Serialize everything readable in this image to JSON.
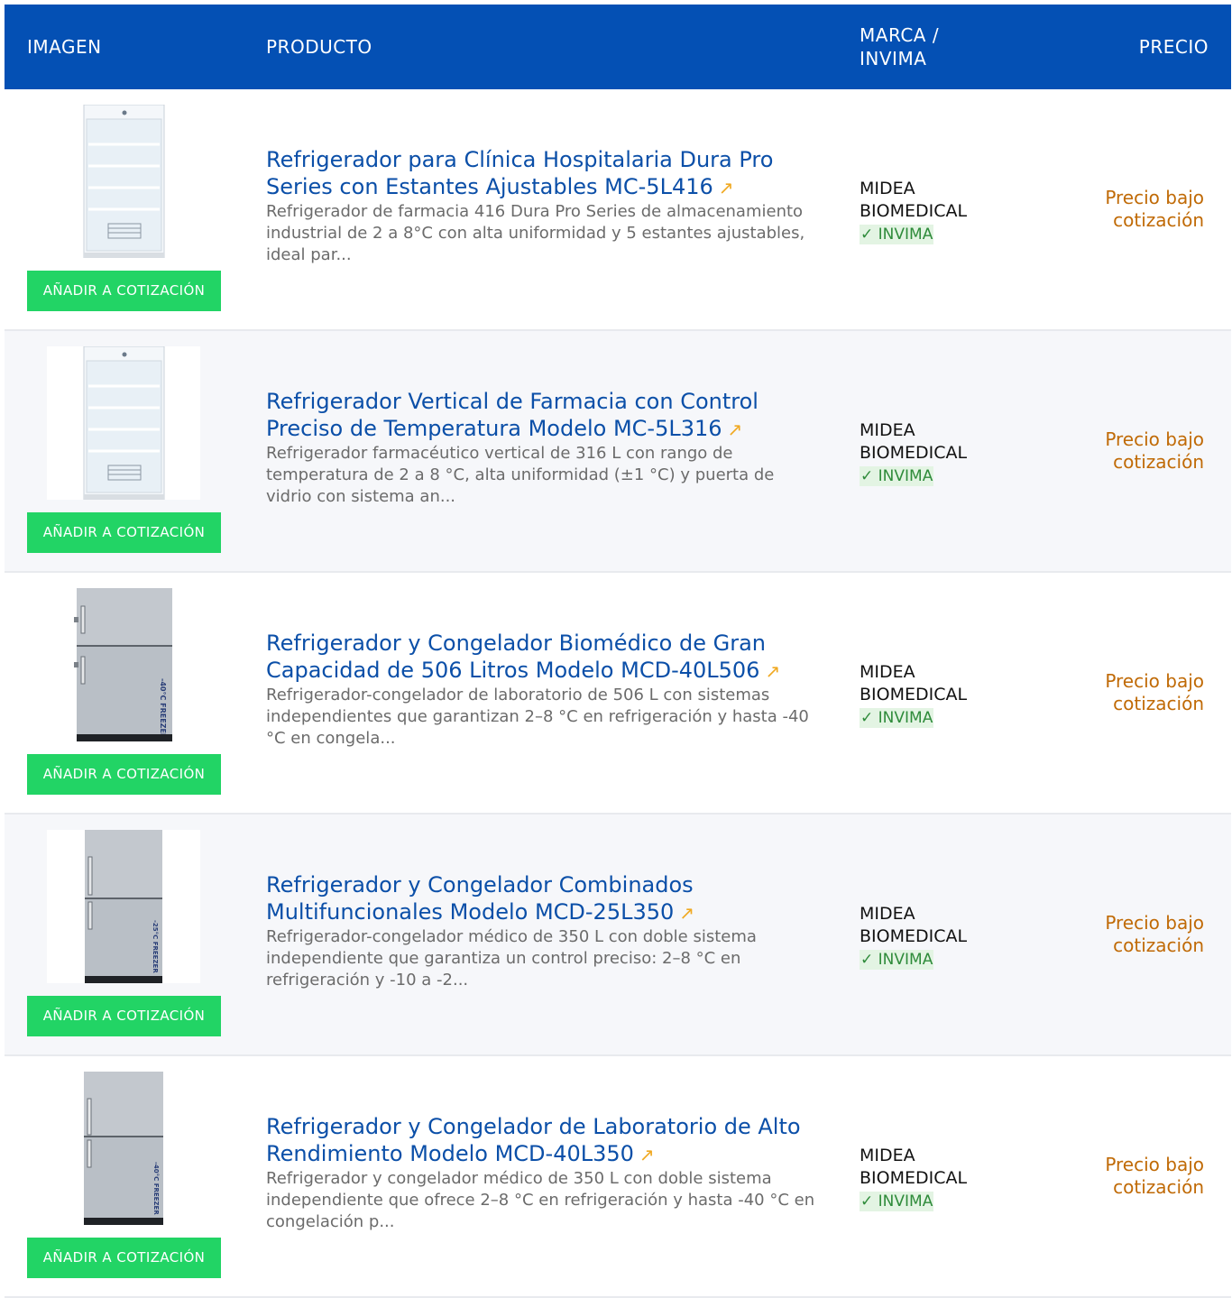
{
  "header": {
    "image": "IMAGEN",
    "product": "PRODUCTO",
    "brand": "MARCA / INVIMA",
    "price": "PRECIO"
  },
  "add_label": "AÑADIR A COTIZACIÓN",
  "rows": [
    {
      "title": "Refrigerador para Clínica Hospitalaria Dura Pro Series con Estantes Ajustables MC-5L416",
      "desc": "Refrigerador de farmacia 416 Dura Pro Series de almacenamiento industrial de 2 a 8°C con alta uniformidad y 5 estantes ajustables, ideal par...",
      "brand": "MIDEA BIOMEDICAL",
      "invima": "✓ INVIMA",
      "price": "Precio bajo cotización",
      "image_icon": "glass-door-refrigerator-icon"
    },
    {
      "title": "Refrigerador Vertical de Farmacia con Control Preciso de Temperatura Modelo MC-5L316",
      "desc": "Refrigerador farmacéutico vertical de 316 L con rango de temperatura de 2 a 8 °C, alta uniformidad (±1 °C) y puerta de vidrio con sistema an...",
      "brand": "MIDEA BIOMEDICAL",
      "invima": "✓ INVIMA",
      "price": "Precio bajo cotización",
      "image_icon": "glass-door-refrigerator-icon"
    },
    {
      "title": "Refrigerador y Congelador Biomédico de Gran Capacidad de 506 Litros Modelo MCD-40L506",
      "desc": "Refrigerador-congelador de laboratorio de 506 L con sistemas independientes que garantizan 2–8 °C en refrigeración y hasta -40 °C en congela...",
      "brand": "MIDEA BIOMEDICAL",
      "invima": "✓ INVIMA",
      "price": "Precio bajo cotización",
      "image_icon": "fridge-freezer-icon",
      "freezer_label": "-40°C FREEZER"
    },
    {
      "title": "Refrigerador y Congelador Combinados Multifuncionales Modelo MCD-25L350",
      "desc": "Refrigerador-congelador médico de 350 L con doble sistema independiente que garantiza un control preciso: 2–8 °C en refrigeración y -10 a -2...",
      "brand": "MIDEA BIOMEDICAL",
      "invima": "✓ INVIMA",
      "price": "Precio bajo cotización",
      "image_icon": "fridge-freezer-icon",
      "freezer_label": "-25°C FREEZER"
    },
    {
      "title": "Refrigerador y Congelador de Laboratorio de Alto Rendimiento Modelo MCD-40L350",
      "desc": "Refrigerador y congelador médico de 350 L con doble sistema independiente que ofrece 2–8 °C en refrigeración y hasta -40 °C en congelación p...",
      "brand": "MIDEA BIOMEDICAL",
      "invima": "✓ INVIMA",
      "price": "Precio bajo cotización",
      "image_icon": "fridge-freezer-icon",
      "freezer_label": "-40°C FREEZER"
    }
  ]
}
